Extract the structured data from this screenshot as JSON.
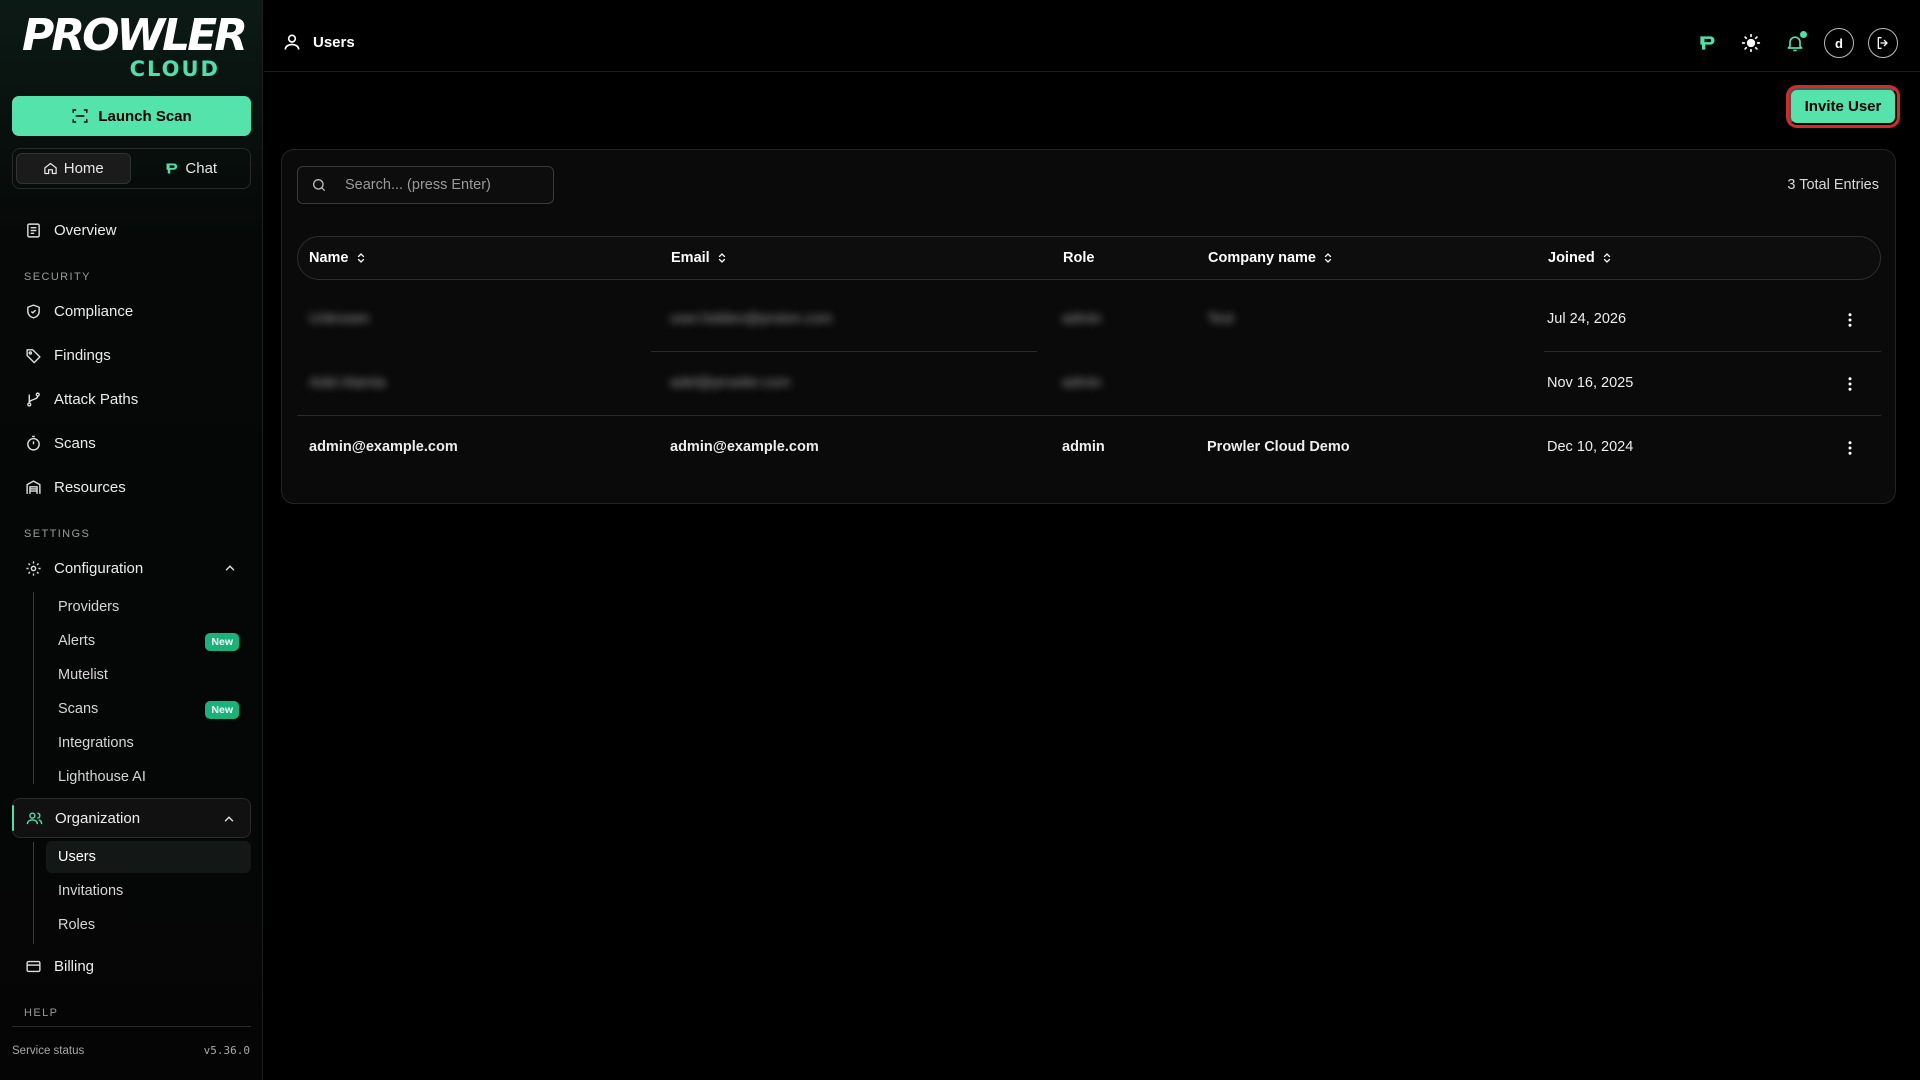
{
  "brand": {
    "name": "PROWLER",
    "sub": "CLOUD"
  },
  "sidebar": {
    "launch_scan": "Launch Scan",
    "home": "Home",
    "chat": "Chat",
    "overview": "Overview",
    "security_label": "SECURITY",
    "security_items": [
      "Compliance",
      "Findings",
      "Attack Paths",
      "Scans",
      "Resources"
    ],
    "settings_label": "SETTINGS",
    "configuration": {
      "label": "Configuration",
      "items": [
        {
          "label": "Providers",
          "badge": ""
        },
        {
          "label": "Alerts",
          "badge": "New"
        },
        {
          "label": "Mutelist",
          "badge": ""
        },
        {
          "label": "Scans",
          "badge": "New"
        },
        {
          "label": "Integrations",
          "badge": ""
        },
        {
          "label": "Lighthouse AI",
          "badge": ""
        }
      ]
    },
    "organization": {
      "label": "Organization",
      "items": [
        "Users",
        "Invitations",
        "Roles"
      ]
    },
    "billing": "Billing",
    "help_label": "HELP",
    "service_status": "Service status",
    "version": "v5.36.0"
  },
  "topbar": {
    "title": "Users",
    "avatar_initial": "d"
  },
  "main": {
    "invite_user": "Invite User",
    "search_placeholder": "Search... (press Enter)",
    "total_entries": "3 Total Entries",
    "columns": [
      "Name",
      "Email",
      "Role",
      "Company name",
      "Joined"
    ],
    "rows": [
      {
        "name": "Unknown",
        "email": "user.hidden@proton.com",
        "role": "admin",
        "company": "Test",
        "joined": "Jul 24, 2026",
        "blurred": true
      },
      {
        "name": "Adel Alamia",
        "email": "adel@prowler.com",
        "role": "admin",
        "company": "",
        "joined": "Nov 16, 2025",
        "blurred": true
      },
      {
        "name": "admin@example.com",
        "email": "admin@example.com",
        "role": "admin",
        "company": "Prowler Cloud Demo",
        "joined": "Dec 10, 2024",
        "blurred": false
      }
    ]
  },
  "colors": {
    "accent": "#55e3ac",
    "brand_green": "#4ee0a9",
    "badge": "#17b37a",
    "highlight_ring": "#d62a2a"
  }
}
